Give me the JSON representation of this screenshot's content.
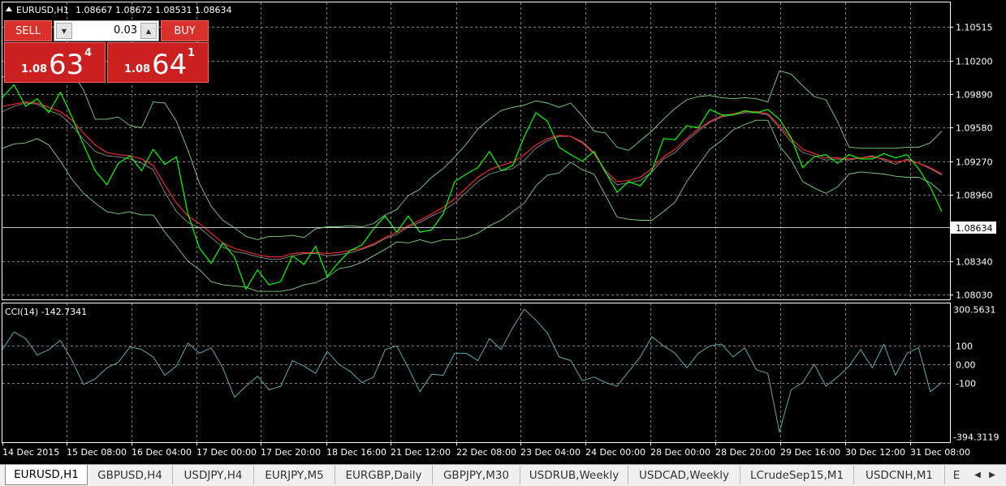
{
  "header": {
    "symbol": "EURUSD,H1",
    "ohlc": "1.08667 1.08672 1.08531 1.08634"
  },
  "trade_panel": {
    "sell_label": "SELL",
    "buy_label": "BUY",
    "lot_value": "0.03",
    "sell_price_prefix": "1.08",
    "sell_price_big": "63",
    "sell_price_sup": "4",
    "buy_price_prefix": "1.08",
    "buy_price_big": "64",
    "buy_price_sup": "1"
  },
  "colors": {
    "price_line": "#00ff00",
    "bands": "#7fd27f",
    "moving_average": "#ff2a2a",
    "cci_line": "#5fa8b0",
    "grid": "#7a7a7a",
    "panel_red": "#cc1f1f"
  },
  "chart_data": [
    {
      "type": "line",
      "title": "EURUSD,H1",
      "y_ticks": [
        "1.10515",
        "1.10200",
        "1.09890",
        "1.09580",
        "1.09270",
        "1.08960",
        "1.08634",
        "1.08340",
        "1.08030"
      ],
      "current_price": "1.08634",
      "x_ticks": [
        "14 Dec 2015",
        "15 Dec 08:00",
        "16 Dec 04:00",
        "17 Dec 00:00",
        "17 Dec 20:00",
        "18 Dec 16:00",
        "21 Dec 12:00",
        "22 Dec 08:00",
        "23 Dec 04:00",
        "24 Dec 00:00",
        "28 Dec 00:00",
        "28 Dec 20:00",
        "29 Dec 16:00",
        "30 Dec 12:00",
        "31 Dec 08:00"
      ],
      "ylim": [
        1.07985,
        1.10745
      ],
      "grid": true,
      "series": [
        {
          "values": [
            1.0986,
            1.0998,
            1.0978,
            1.0985,
            1.0972,
            1.0991,
            1.0968,
            1.0942,
            1.0918,
            1.0905,
            1.0925,
            1.0932,
            1.0918,
            1.0938,
            1.0924,
            1.0931,
            1.0878,
            1.0846,
            1.0832,
            1.0851,
            1.0838,
            1.0808,
            1.0826,
            1.0812,
            1.0815,
            1.0839,
            1.0831,
            1.0848,
            1.082,
            1.0833,
            1.0844,
            1.0849,
            1.0864,
            1.0876,
            1.0861,
            1.0876,
            1.0861,
            1.0863,
            1.0878,
            1.0908,
            1.0915,
            1.0921,
            1.0936,
            1.0918,
            1.0923,
            1.095,
            1.0972,
            1.0964,
            1.094,
            1.0933,
            1.0927,
            1.0936,
            1.0917,
            1.0898,
            1.0908,
            1.0904,
            1.0918,
            1.0948,
            1.0947,
            1.096,
            1.0958,
            1.0975,
            1.097,
            1.097,
            1.0974,
            1.0972,
            1.0975,
            1.0966,
            1.0949,
            1.0921,
            1.0931,
            1.0933,
            1.0925,
            1.0933,
            1.0929,
            1.0929,
            1.0934,
            1.093,
            1.0933,
            1.092,
            1.0903,
            1.088
          ]
        },
        {
          "values": [
            1.0973,
            1.0978,
            1.0981,
            1.098,
            1.0974,
            1.097,
            1.096,
            1.0947,
            1.0936,
            1.0932,
            1.0931,
            1.0929,
            1.0925,
            1.0919,
            1.0898,
            1.088,
            1.087,
            1.0865,
            1.0856,
            1.0847,
            1.0843,
            1.0841,
            1.0838,
            1.0836,
            1.0836,
            1.0839,
            1.0841,
            1.0841,
            1.0839,
            1.084,
            1.0842,
            1.0845,
            1.0849,
            1.0855,
            1.0859,
            1.0866,
            1.087,
            1.0876,
            1.0881,
            1.0888,
            1.0898,
            1.0908,
            1.0915,
            1.0918,
            1.092,
            1.0928,
            1.0939,
            1.0946,
            1.095,
            1.095,
            1.0945,
            1.0935,
            1.0916,
            1.0905,
            1.0907,
            1.0909,
            1.0917,
            1.0929,
            1.0935,
            1.0946,
            1.0955,
            1.0963,
            1.0968,
            1.097,
            1.0972,
            1.0972,
            1.097,
            1.0958,
            1.0945,
            1.0935,
            1.0932,
            1.0928,
            1.0929,
            1.0928,
            1.093,
            1.0932,
            1.0928,
            1.0924,
            1.0929,
            1.0925,
            1.092,
            1.0914
          ]
        },
        {
          "values": [
            1.1005,
            1.101,
            1.1012,
            1.1004,
            1.1006,
            1.1012,
            1.101,
            1.0993,
            1.0966,
            1.0966,
            1.0968,
            1.096,
            1.0958,
            1.0982,
            1.0981,
            1.0964,
            1.0937,
            1.0906,
            1.0885,
            1.0872,
            1.0865,
            1.0857,
            1.0854,
            1.0857,
            1.0857,
            1.0858,
            1.0856,
            1.0864,
            1.0866,
            1.0866,
            1.0867,
            1.0866,
            1.0869,
            1.0877,
            1.0882,
            1.0895,
            1.0901,
            1.0912,
            1.092,
            1.0931,
            1.0943,
            1.0957,
            1.0966,
            1.0974,
            1.0977,
            1.0979,
            1.0983,
            1.0981,
            1.0977,
            1.0981,
            1.0969,
            1.0955,
            1.0953,
            1.094,
            1.0937,
            1.0946,
            1.0955,
            1.0966,
            1.0976,
            1.0984,
            1.0987,
            1.0988,
            1.0986,
            1.0985,
            1.0986,
            1.0985,
            1.0982,
            1.1011,
            1.1008,
            1.0997,
            1.0987,
            1.0984,
            1.0964,
            1.094,
            1.0939,
            1.0939,
            1.0939,
            1.0939,
            1.094,
            1.094,
            1.0944,
            1.0955
          ]
        },
        {
          "values": [
            1.0939,
            1.0943,
            1.0944,
            1.0948,
            1.0942,
            1.0927,
            1.091,
            1.0897,
            1.0888,
            1.088,
            1.0878,
            1.088,
            1.0877,
            1.0877,
            1.0861,
            1.0848,
            1.0834,
            1.0826,
            1.0815,
            1.0812,
            1.0811,
            1.081,
            1.0806,
            1.0806,
            1.0806,
            1.0808,
            1.0812,
            1.0814,
            1.0819,
            1.0827,
            1.0829,
            1.0833,
            1.0839,
            1.0845,
            1.0852,
            1.0851,
            1.0854,
            1.0851,
            1.0854,
            1.0854,
            1.0856,
            1.086,
            1.0867,
            1.0872,
            1.088,
            1.0888,
            1.0904,
            1.0914,
            1.0916,
            1.0926,
            1.0919,
            1.0915,
            1.0895,
            1.0875,
            1.0873,
            1.0872,
            1.0872,
            1.088,
            1.0889,
            1.0908,
            1.0923,
            1.0938,
            1.0946,
            1.0956,
            1.0961,
            1.0965,
            1.0965,
            1.0941,
            1.0928,
            1.0908,
            1.0902,
            1.0897,
            1.0903,
            1.0915,
            1.0917,
            1.0916,
            1.0915,
            1.0913,
            1.0912,
            1.0912,
            1.0907,
            1.0898
          ]
        },
        {
          "values": [
            1.0978,
            1.098,
            1.0982,
            1.0981,
            1.0977,
            1.0973,
            1.0965,
            1.0953,
            1.0942,
            1.0935,
            1.0933,
            1.0932,
            1.0929,
            1.0923,
            1.0905,
            1.0888,
            1.0876,
            1.0869,
            1.086,
            1.0851,
            1.0846,
            1.0843,
            1.084,
            1.0838,
            1.0838,
            1.0841,
            1.0842,
            1.0842,
            1.0841,
            1.0842,
            1.0844,
            1.0846,
            1.085,
            1.0856,
            1.0861,
            1.0867,
            1.0872,
            1.0878,
            1.0884,
            1.0892,
            1.0902,
            1.0912,
            1.0919,
            1.0923,
            1.0926,
            1.0933,
            1.0942,
            1.0948,
            1.0951,
            1.095,
            1.0944,
            1.0934,
            1.0918,
            1.0908,
            1.0909,
            1.0912,
            1.092,
            1.0931,
            1.0938,
            1.0948,
            1.0957,
            1.0964,
            1.0969,
            1.0971,
            1.0973,
            1.0973,
            1.0971,
            1.096,
            1.0948,
            1.0938,
            1.0934,
            1.093,
            1.093,
            1.0929,
            1.093,
            1.0931,
            1.0929,
            1.0926,
            1.0928,
            1.0925,
            1.0921,
            1.0915
          ]
        }
      ]
    },
    {
      "type": "line",
      "title": "CCI(14) -142.7341",
      "y_ticks": [
        "300.5631",
        "100",
        "0.00",
        "-100",
        "-394.3119"
      ],
      "ylim": [
        -394.3119,
        300.5631
      ],
      "grid": true,
      "series": [
        {
          "values": [
            80,
            176,
            140,
            50,
            80,
            130,
            20,
            -110,
            -80,
            -20,
            10,
            95,
            80,
            40,
            -60,
            -10,
            115,
            60,
            90,
            -20,
            -180,
            -120,
            -65,
            -140,
            -120,
            20,
            -10,
            -50,
            70,
            0,
            -40,
            -100,
            -70,
            80,
            100,
            -20,
            -150,
            -55,
            -60,
            60,
            60,
            20,
            140,
            80,
            200,
            300,
            240,
            170,
            40,
            20,
            -90,
            -70,
            -100,
            -120,
            -40,
            40,
            150,
            100,
            60,
            -20,
            60,
            100,
            110,
            40,
            90,
            -30,
            -50,
            -370,
            -140,
            -100,
            0,
            -120,
            -70,
            -10,
            80,
            -20,
            110,
            -60,
            60,
            90,
            -150,
            -100
          ]
        }
      ]
    }
  ],
  "tabs": [
    {
      "label": "EURUSD,H1",
      "active": true
    },
    {
      "label": "GBPUSD,H4",
      "active": false
    },
    {
      "label": "USDJPY,H4",
      "active": false
    },
    {
      "label": "EURJPY,M5",
      "active": false
    },
    {
      "label": "EURGBP,Daily",
      "active": false
    },
    {
      "label": "GBPJPY,M30",
      "active": false
    },
    {
      "label": "USDRUB,Weekly",
      "active": false
    },
    {
      "label": "USDCAD,Weekly",
      "active": false
    },
    {
      "label": "LCrudeSep15,M1",
      "active": false
    },
    {
      "label": "USDCNH,M1",
      "active": false
    },
    {
      "label": "E",
      "active": false
    }
  ]
}
